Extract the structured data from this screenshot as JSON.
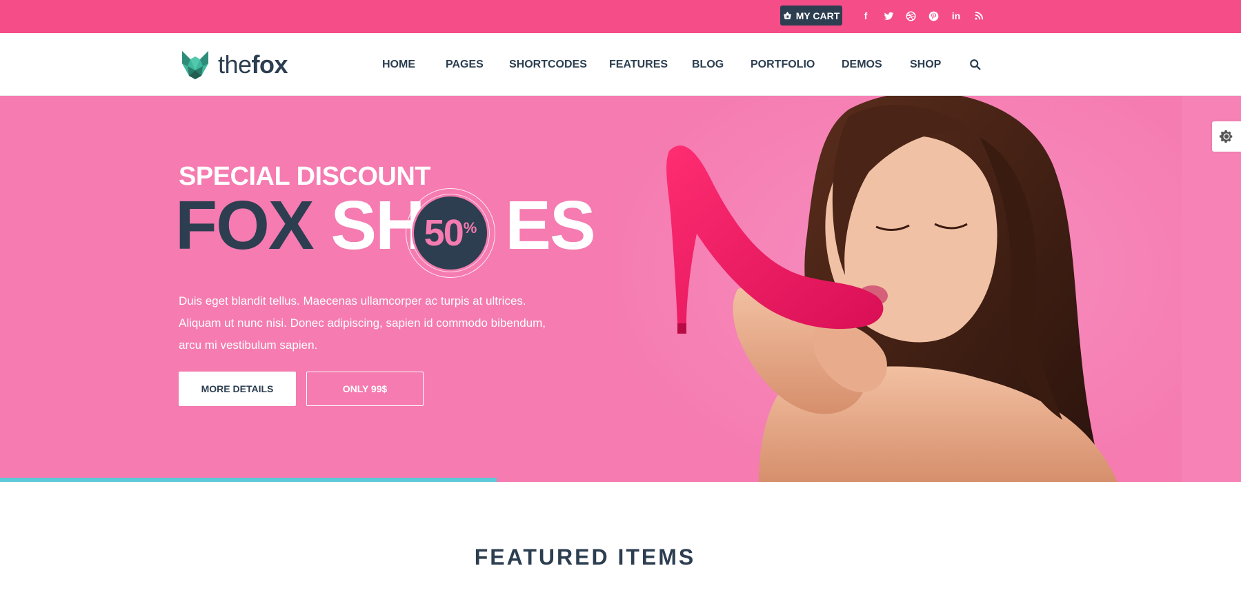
{
  "colors": {
    "topbar": "#f54d88",
    "hero_bg": "#f57bb0",
    "dark": "#2c3e50",
    "accent_progress": "#5ec9d8",
    "shoe": "#ff1f68"
  },
  "topbar": {
    "cart_label": "MY CART",
    "cart_icon": "basket-icon",
    "social": [
      {
        "name": "facebook-icon",
        "glyph": "f"
      },
      {
        "name": "twitter-icon",
        "glyph": "t"
      },
      {
        "name": "dribbble-icon",
        "glyph": "◎"
      },
      {
        "name": "pinterest-icon",
        "glyph": "p"
      },
      {
        "name": "linkedin-icon",
        "glyph": "in"
      },
      {
        "name": "rss-icon",
        "glyph": "◔"
      }
    ]
  },
  "header": {
    "logo_prefix": "the",
    "logo_bold": "fox",
    "nav": [
      "HOME",
      "PAGES",
      "SHORTCODES",
      "FEATURES",
      "BLOG",
      "PORTFOLIO",
      "DEMOS",
      "SHOP"
    ]
  },
  "hero": {
    "subtitle": "SPECIAL DISCOUNT",
    "title_dark": "FOX",
    "title_light_a": "SH",
    "title_light_b": "ES",
    "badge_number": "50",
    "badge_percent": "%",
    "description": "Duis eget blandit tellus. Maecenas ullamcorper ac turpis at ultrices. Aliquam ut nunc nisi. Donec adipiscing, sapien id commodo bibendum, arcu mi vestibulum sapien.",
    "primary_button": "MORE DETAILS",
    "secondary_button": "ONLY 99$",
    "slide_progress": 0.4
  },
  "featured": {
    "title": "FEATURED ITEMS"
  }
}
